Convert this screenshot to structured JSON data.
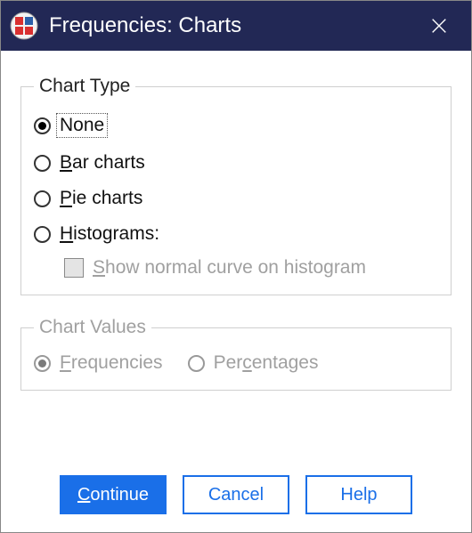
{
  "window": {
    "title": "Frequencies: Charts"
  },
  "chart_type": {
    "legend": "Chart Type",
    "options": {
      "none": {
        "label": "None",
        "selected": true,
        "focused": true
      },
      "bar": {
        "label": "Bar charts",
        "mnemonic_index": 0,
        "selected": false
      },
      "pie": {
        "label": "Pie charts",
        "mnemonic_index": 0,
        "selected": false
      },
      "hist": {
        "label": "Histograms:",
        "mnemonic_index": 0,
        "selected": false
      }
    },
    "show_normal_curve": {
      "label": "Show normal curve on histogram",
      "mnemonic_index": 0,
      "checked": false,
      "enabled": false
    }
  },
  "chart_values": {
    "legend": "Chart Values",
    "enabled": false,
    "options": {
      "frequencies": {
        "label": "Frequencies",
        "mnemonic_index": 0,
        "selected": true
      },
      "percentages": {
        "label": "Percentages",
        "mnemonic_index": 3,
        "selected": false
      }
    }
  },
  "buttons": {
    "continue": "Continue",
    "cancel": "Cancel",
    "help": "Help"
  }
}
